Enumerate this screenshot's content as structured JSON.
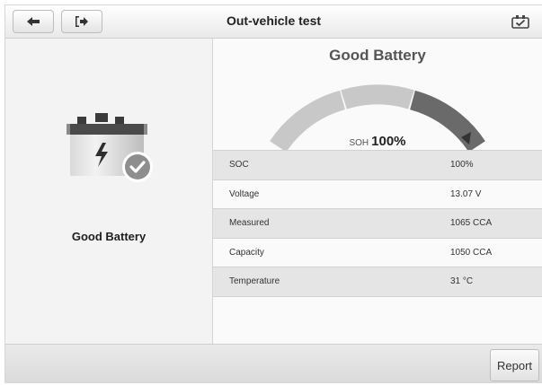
{
  "header": {
    "title": "Out-vehicle test",
    "back_icon": "arrow-left-icon",
    "exit_icon": "exit-icon",
    "vci_icon": "vci-connected-icon"
  },
  "left": {
    "battery_icon": "battery-check-icon",
    "status_label": "Good Battery"
  },
  "result": {
    "title": "Good Battery",
    "soh_label": "SOH",
    "soh_value": "100%",
    "gauge_level": 1.0
  },
  "measurements": [
    {
      "label": "SOC",
      "value": "100%"
    },
    {
      "label": "Voltage",
      "value": "13.07 V"
    },
    {
      "label": "Measured",
      "value": "1065 CCA"
    },
    {
      "label": "Capacity",
      "value": "1050 CCA"
    },
    {
      "label": "Temperature",
      "value": "31 °C"
    }
  ],
  "footer": {
    "report_label": "Report"
  },
  "colors": {
    "gauge_light": "#c8c8c8",
    "gauge_dark": "#6a6a6a",
    "accent": "#777777"
  }
}
